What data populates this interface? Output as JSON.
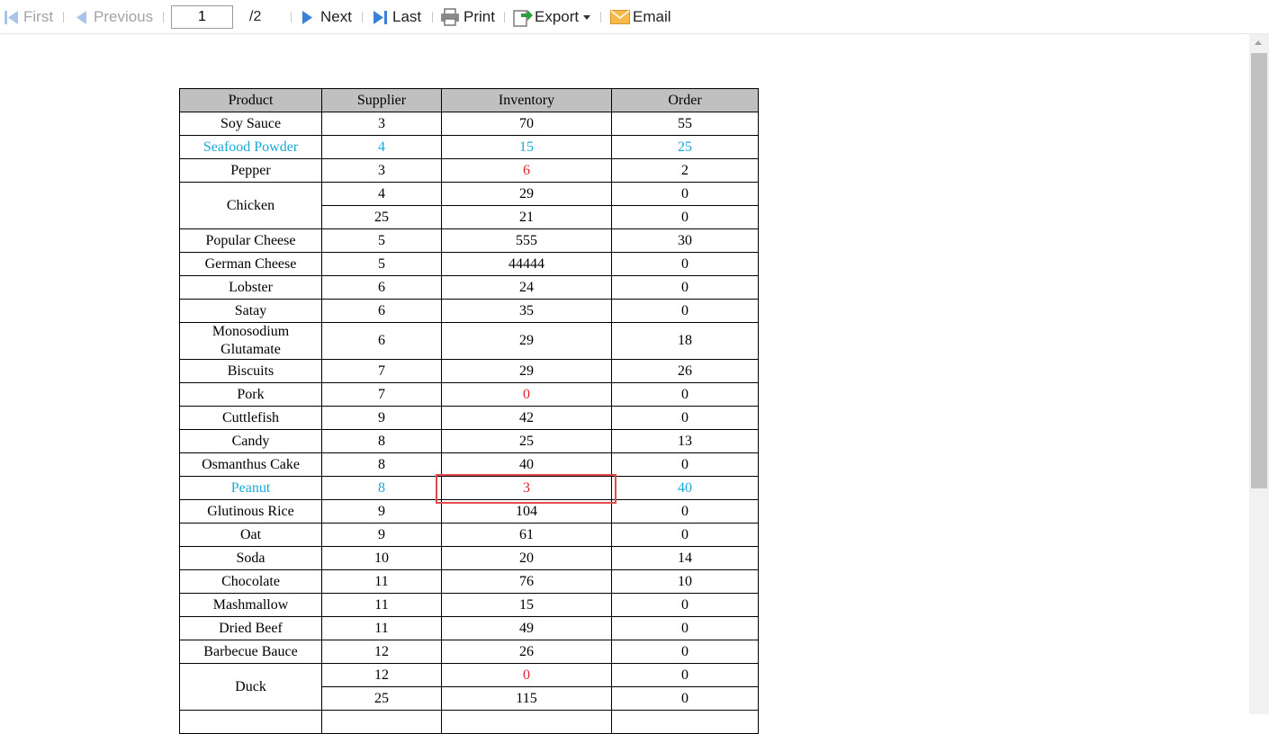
{
  "toolbar": {
    "first_label": "First",
    "previous_label": "Previous",
    "page_value": "1",
    "page_total": "/2",
    "next_label": "Next",
    "last_label": "Last",
    "print_label": "Print",
    "export_label": "Export",
    "email_label": "Email"
  },
  "table": {
    "headers": [
      "Product",
      "Supplier",
      "Inventory",
      "Order"
    ],
    "rows": [
      {
        "product": "Soy Sauce",
        "supplier": "3",
        "inventory": "70",
        "order": "55"
      },
      {
        "product": "Seafood Powder",
        "supplier": "4",
        "inventory": "15",
        "order": "25",
        "style": "cyan"
      },
      {
        "product": "Pepper",
        "supplier": "3",
        "inventory": "6",
        "order": "2",
        "inventory_style": "red"
      },
      {
        "product": "Chicken",
        "supplier": "4",
        "inventory": "29",
        "order": "0",
        "product_rowspan": 2
      },
      {
        "supplier": "25",
        "inventory": "21",
        "order": "0",
        "continued": true
      },
      {
        "product": "Popular Cheese",
        "supplier": "5",
        "inventory": "555",
        "order": "30"
      },
      {
        "product": "German Cheese",
        "supplier": "5",
        "inventory": "44444",
        "order": "0"
      },
      {
        "product": "Lobster",
        "supplier": "6",
        "inventory": "24",
        "order": "0"
      },
      {
        "product": "Satay",
        "supplier": "6",
        "inventory": "35",
        "order": "0"
      },
      {
        "product": "Monosodium Glutamate",
        "supplier": "6",
        "inventory": "29",
        "order": "18",
        "tall": true
      },
      {
        "product": "Biscuits",
        "supplier": "7",
        "inventory": "29",
        "order": "26"
      },
      {
        "product": "Pork",
        "supplier": "7",
        "inventory": "0",
        "order": "0",
        "inventory_style": "red"
      },
      {
        "product": "Cuttlefish",
        "supplier": "9",
        "inventory": "42",
        "order": "0"
      },
      {
        "product": "Candy",
        "supplier": "8",
        "inventory": "25",
        "order": "13"
      },
      {
        "product": "Osmanthus Cake",
        "supplier": "8",
        "inventory": "40",
        "order": "0"
      },
      {
        "product": "Peanut",
        "supplier": "8",
        "inventory": "3",
        "order": "40",
        "style": "cyan",
        "inventory_style": "red"
      },
      {
        "product": "Glutinous Rice",
        "supplier": "9",
        "inventory": "104",
        "order": "0"
      },
      {
        "product": "Oat",
        "supplier": "9",
        "inventory": "61",
        "order": "0"
      },
      {
        "product": "Soda",
        "supplier": "10",
        "inventory": "20",
        "order": "14"
      },
      {
        "product": "Chocolate",
        "supplier": "11",
        "inventory": "76",
        "order": "10"
      },
      {
        "product": "Mashmallow",
        "supplier": "11",
        "inventory": "15",
        "order": "0"
      },
      {
        "product": "Dried Beef",
        "supplier": "11",
        "inventory": "49",
        "order": "0"
      },
      {
        "product": "Barbecue Bauce",
        "supplier": "12",
        "inventory": "26",
        "order": "0"
      },
      {
        "product": "Duck",
        "supplier": "12",
        "inventory": "0",
        "order": "0",
        "product_rowspan": 2,
        "inventory_style": "red"
      },
      {
        "supplier": "25",
        "inventory": "115",
        "order": "0",
        "continued": true
      },
      {
        "product": "",
        "supplier": "",
        "inventory": "",
        "order": ""
      }
    ]
  },
  "colors": {
    "disabled_text": "#a4a4a4",
    "nav_blue": "#3b7fd6",
    "highlight_cyan": "#1ba8d6",
    "alert_red": "#e0202a",
    "header_gray": "#c0c0c0",
    "annotation_box": "#e24b4b"
  },
  "icons": {
    "first": "first-page-icon",
    "previous": "previous-page-icon",
    "next": "next-page-icon",
    "last": "last-page-icon",
    "print": "printer-icon",
    "export": "export-icon",
    "email": "envelope-icon"
  }
}
